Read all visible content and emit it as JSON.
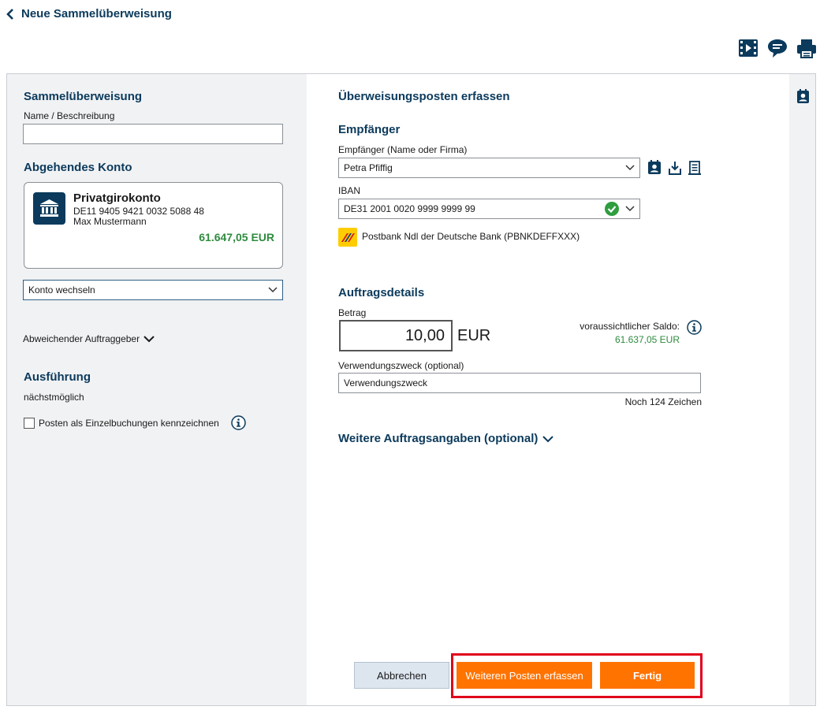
{
  "header": {
    "back_label": "Neue Sammelüberweisung"
  },
  "toolbar": {
    "icons": [
      "video-icon",
      "chat-icon",
      "print-icon"
    ]
  },
  "left": {
    "section_title": "Sammelüberweisung",
    "name_label": "Name / Beschreibung",
    "name_value": "",
    "account_section_title": "Abgehendes Konto",
    "account": {
      "name": "Privatgirokonto",
      "iban": "DE11 9405 9421 0032 5088 48",
      "owner": "Max Mustermann",
      "balance": "61.647,05 EUR"
    },
    "switch_account_label": "Konto wechseln",
    "other_originator_label": "Abweichender Auftraggeber",
    "execution_title": "Ausführung",
    "execution_value": "nächstmöglich",
    "single_booking_label": "Posten als Einzelbuchungen kennzeichnen",
    "single_booking_checked": false
  },
  "main": {
    "title": "Überweisungsposten erfassen",
    "recipient_title": "Empfänger",
    "recipient_label": "Empfänger (Name oder Firma)",
    "recipient_value": "Petra Pfiffig",
    "iban_label": "IBAN",
    "iban_value": "DE31 2001 0020 9999 9999 99",
    "bank_name": "Postbank Ndl der Deutsche Bank",
    "bank_bic": "(PBNKDEFFXXX)",
    "details_title": "Auftragsdetails",
    "amount_label": "Betrag",
    "amount_value": "10,00",
    "currency": "EUR",
    "balance_label": "voraussichtlicher Saldo:",
    "balance_value": "61.637,05 EUR",
    "purpose_label": "Verwendungszweck (optional)",
    "purpose_value": "Verwendungszweck",
    "remaining_chars": "Noch 124 Zeichen",
    "more_details_label": "Weitere Auftragsangaben (optional)"
  },
  "buttons": {
    "cancel": "Abbrechen",
    "add_more": "Weiteren Posten erfassen",
    "done": "Fertig"
  },
  "colors": {
    "brand_dark": "#0b3a5c",
    "accent_orange": "#ff7300",
    "positive_green": "#2e8b3e",
    "highlight_red": "#e0001b"
  }
}
